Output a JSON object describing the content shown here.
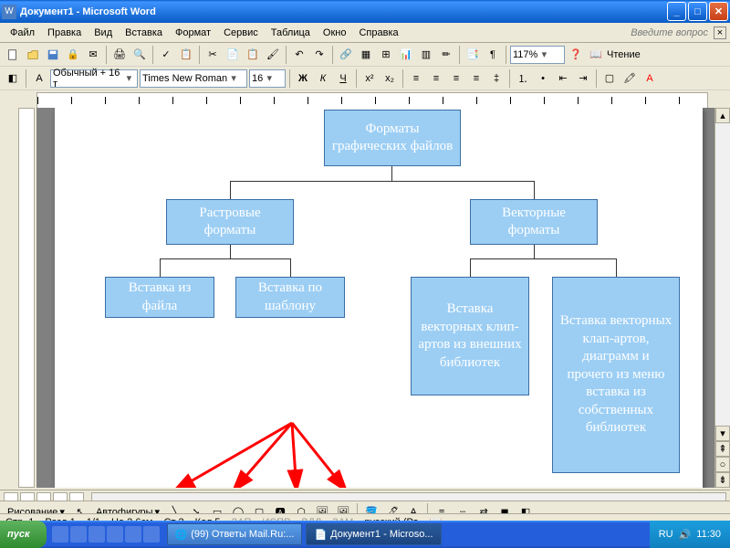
{
  "window": {
    "title": "Документ1 - Microsoft Word",
    "doc_icon": "W"
  },
  "menu": {
    "items": [
      "Файл",
      "Правка",
      "Вид",
      "Вставка",
      "Формат",
      "Сервис",
      "Таблица",
      "Окно",
      "Справка"
    ],
    "ask": "Введите вопрос"
  },
  "format": {
    "style": "Обычный + 16 т",
    "font": "Times New Roman",
    "size": "16",
    "zoom": "117%",
    "read": "Чтение"
  },
  "chart_data": {
    "type": "tree",
    "root": {
      "label": "Форматы\nграфических\nфайлов",
      "children": [
        {
          "label": "Растровые\nформаты",
          "children": [
            {
              "label": "Вставка\nиз файла"
            },
            {
              "label": "Вставка\nпо шаблону"
            }
          ]
        },
        {
          "label": "Векторные\nформаты",
          "children": [
            {
              "label": "Вставка\nвекторных\nклип-артов\nиз внешних\nбиблиотек"
            },
            {
              "label": "Вставка\nвекторных\nклап-артов,\nдиаграмм и\nпрочего из\nменю\nвставка из\nсобственных\nбиблиотек"
            }
          ]
        }
      ]
    }
  },
  "org": {
    "n1": "Форматы графических файлов",
    "n2": "Растровые форматы",
    "n3": "Векторные форматы",
    "n4": "Вставка из файла",
    "n5": "Вставка по шаблону",
    "n6": "Вставка векторных клип-артов из внешних библиотек",
    "n7": "Вставка векторных клап-артов, диаграмм и прочего из меню вставка из собственных библиотек"
  },
  "draw": {
    "menu": "Рисование",
    "autoshapes": "Автофигуры"
  },
  "status": {
    "page": "Стр. 1",
    "sect": "Разд 1",
    "pages": "1/1",
    "at": "На 2,6см",
    "ln": "Ст 2",
    "col": "Кол 5",
    "rec": "ЗАП",
    "trk": "ИСПР",
    "ext": "ВДЛ",
    "ovr": "ЗАМ",
    "lang": "русский (Ро"
  },
  "taskbar": {
    "start": "пуск",
    "task1": "(99) Ответы Mail.Ru:...",
    "task2": "Документ1 - Microso...",
    "lang": "RU",
    "time": "11:30"
  }
}
